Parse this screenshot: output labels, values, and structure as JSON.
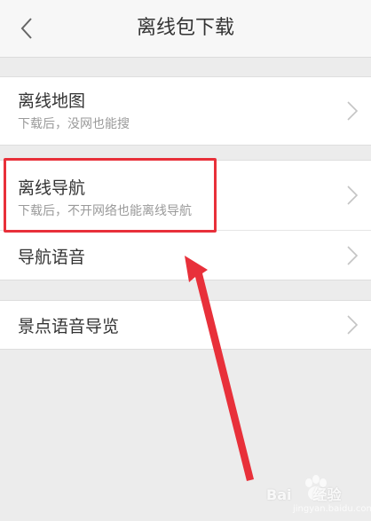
{
  "header": {
    "title": "离线包下载",
    "back_icon": "chevron-left-icon"
  },
  "groups": [
    {
      "items": [
        {
          "title": "离线地图",
          "subtitle": "下载后，没网也能搜"
        }
      ]
    },
    {
      "items": [
        {
          "title": "离线导航",
          "subtitle": "下载后，不开网络也能离线导航"
        },
        {
          "title": "导航语音",
          "subtitle": ""
        }
      ]
    },
    {
      "items": [
        {
          "title": "景点语音导览",
          "subtitle": ""
        }
      ]
    }
  ],
  "annotation": {
    "highlight_color": "#e8303a",
    "arrow_color": "#e8303a"
  },
  "watermark": {
    "brand": "Bai",
    "brand_suffix": "经验",
    "url": "jingyan.baidu.com"
  }
}
